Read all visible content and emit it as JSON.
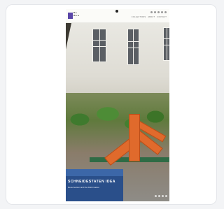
{
  "site": {
    "logo_text": "D▲\nD▲▲",
    "nav": [
      "COLLECTIONS",
      "ABOUT",
      "CONTACT"
    ]
  },
  "hero": {
    "title": "SCHNEIDESTATEN IDEA",
    "subtitle": "Resurrection and the Reformation",
    "slides_count": 4
  }
}
